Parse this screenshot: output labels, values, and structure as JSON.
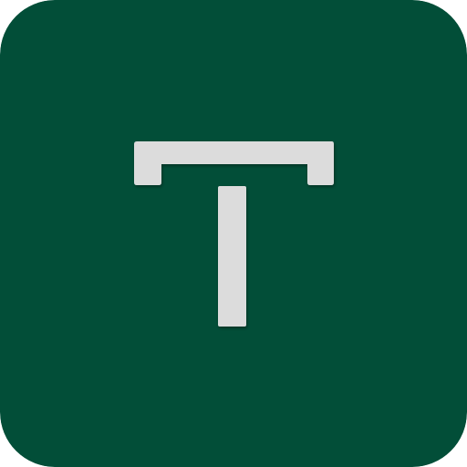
{
  "icon": {
    "name": "t-letter-icon",
    "background_color": "#024E38",
    "glyph_color": "#DCDCDC"
  }
}
